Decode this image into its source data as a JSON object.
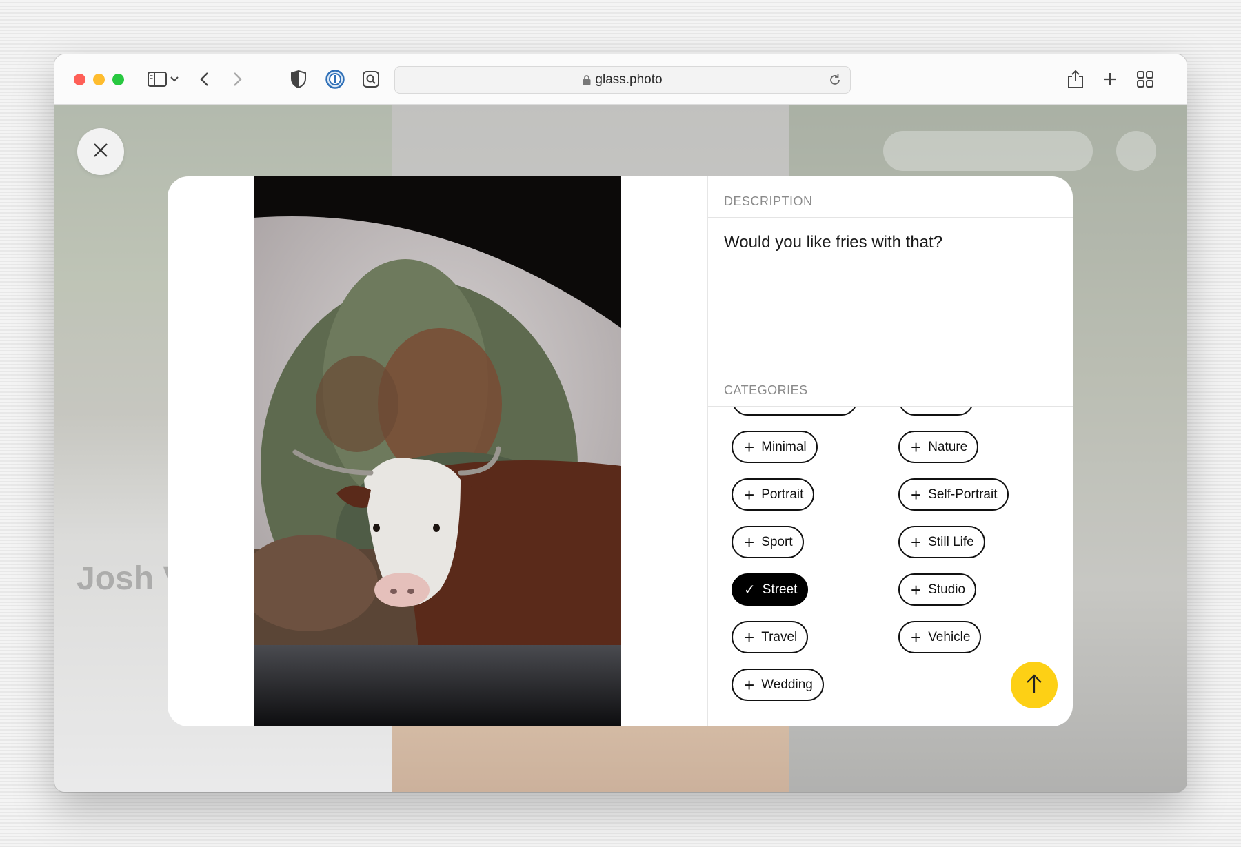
{
  "browser": {
    "url": "glass.photo"
  },
  "background": {
    "profile_name": "Josh V"
  },
  "modal": {
    "description_label": "DESCRIPTION",
    "description_text": "Would you like fries with that?",
    "categories_label": "CATEGORIES",
    "categories": [
      {
        "label": "Minimal",
        "selected": false
      },
      {
        "label": "Nature",
        "selected": false
      },
      {
        "label": "Portrait",
        "selected": false
      },
      {
        "label": "Self-Portrait",
        "selected": false
      },
      {
        "label": "Sport",
        "selected": false
      },
      {
        "label": "Still Life",
        "selected": false
      },
      {
        "label": "Street",
        "selected": true
      },
      {
        "label": "Studio",
        "selected": false
      },
      {
        "label": "Travel",
        "selected": false
      },
      {
        "label": "Vehicle",
        "selected": false
      },
      {
        "label": "Wedding",
        "selected": false
      }
    ]
  },
  "icons": {
    "close": "close-icon",
    "submit": "arrow-up-icon",
    "add": "plus-icon",
    "selected": "checkmark-icon"
  },
  "colors": {
    "submit_button": "#fdd015",
    "selected_chip": "#000000"
  }
}
